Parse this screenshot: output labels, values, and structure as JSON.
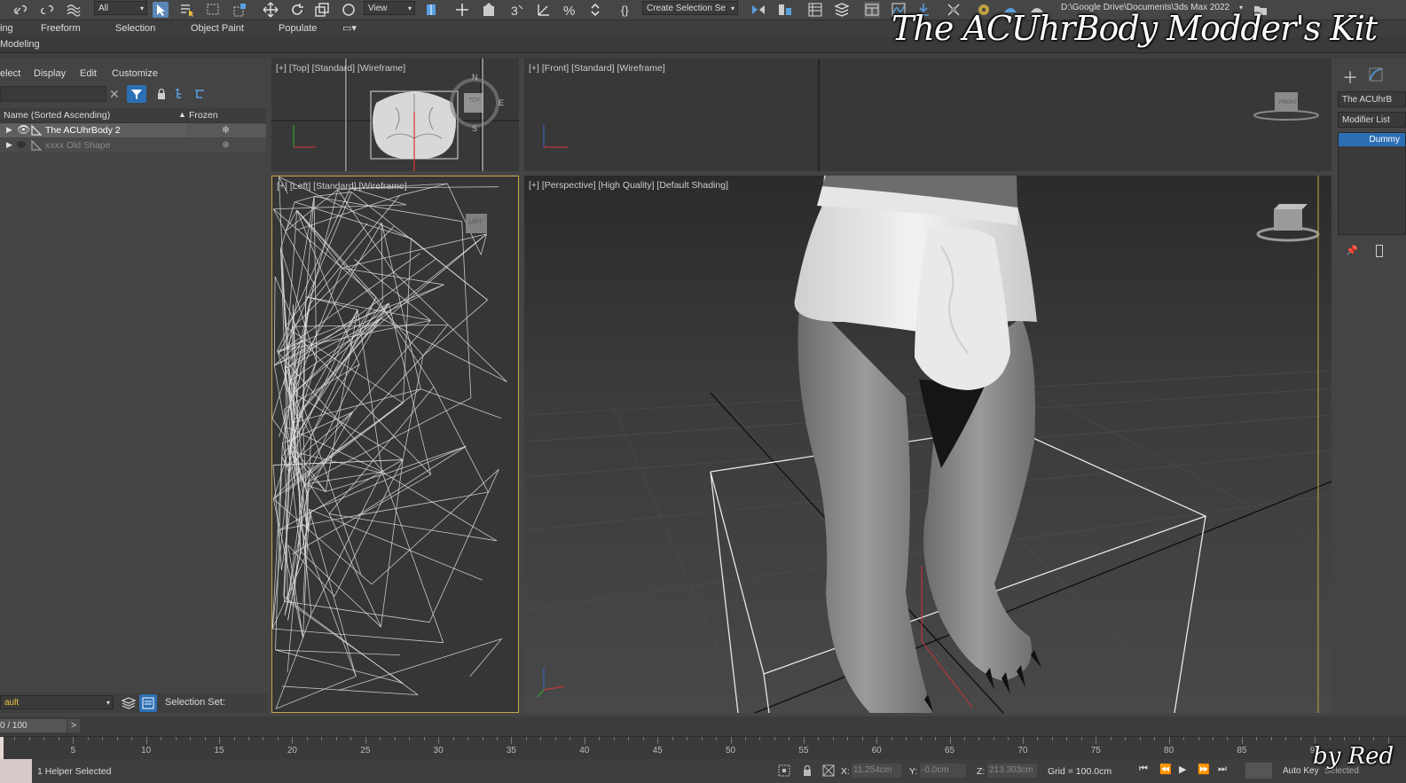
{
  "toolbar": {
    "filter_value": "All",
    "view_value": "View",
    "selection_set_value": "Create Selection Se",
    "project_path": "D:\\Google Drive\\Documents\\3ds Max 2022"
  },
  "ribbon": {
    "tabs": [
      "ing",
      "Freeform",
      "Selection",
      "Object Paint",
      "Populate"
    ],
    "sub_tab": "Modeling"
  },
  "explorer": {
    "menu": [
      "elect",
      "Display",
      "Edit",
      "Customize"
    ],
    "columns": {
      "name": "Name (Sorted Ascending)",
      "frozen": "Frozen"
    },
    "rows": [
      {
        "name": "The ACUhrBody 2"
      },
      {
        "name": "xxxx Old Shape"
      }
    ],
    "layer_value": "ault",
    "selection_set_label": "Selection Set:"
  },
  "viewports": {
    "top": "[+] [Top] [Standard] [Wireframe]",
    "front": "[+] [Front] [Standard] [Wireframe]",
    "left": "[+] [Left] [Standard] [Wireframe]",
    "perspective": "[+] [Perspective] [High Quality] [Default Shading]",
    "cube_top": "TOP",
    "cube_front": "FRONT",
    "cube_left": "LEFT",
    "compass": {
      "n": "N",
      "e": "E",
      "s": "S"
    }
  },
  "command_panel": {
    "object_name": "The ACUhrB",
    "modifier_list": "Modifier List",
    "stack_item": "Dummy"
  },
  "timeline": {
    "frame_counter": "0 / 100",
    "next": ">",
    "ticks": [
      "5",
      "10",
      "15",
      "20",
      "25",
      "30",
      "35",
      "40",
      "45",
      "50",
      "55",
      "60",
      "65",
      "70",
      "75",
      "80",
      "85",
      "90"
    ]
  },
  "status": {
    "selection_info": "1 Helper Selected",
    "x_label": "X:",
    "x_value": "11.254cm",
    "y_label": "Y:",
    "y_value": "-0.0cm",
    "z_label": "Z:",
    "z_value": "213.303cm",
    "grid": "Grid = 100.0cm",
    "auto_key": "Auto Key",
    "selected": "Selected"
  },
  "overlay": {
    "title": "The ACUhrBody Modder's Kit",
    "byline": "by Red"
  },
  "colors": {
    "accent": "#2d6fb5",
    "viewport_active": "#c8a84a",
    "viewport_bg": "#383838"
  }
}
